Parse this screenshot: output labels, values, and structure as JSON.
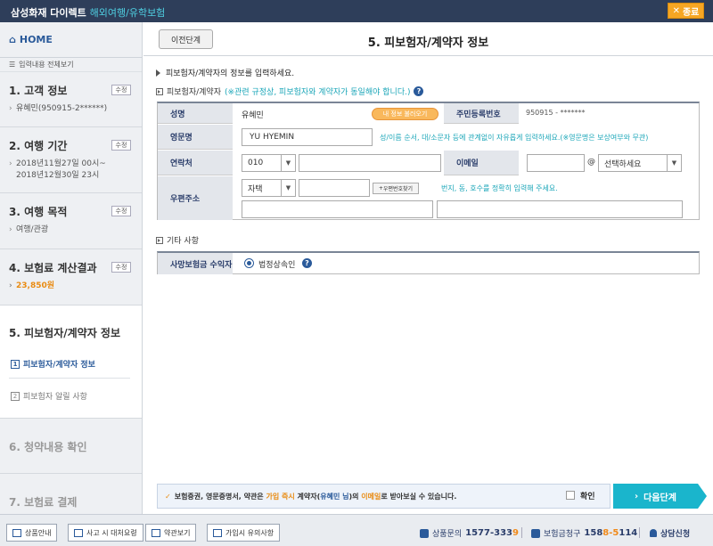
{
  "header": {
    "brand": "삼성화재 다이렉트",
    "sub": "해외여행/유학보험",
    "close": "종료"
  },
  "sidebar": {
    "home": "HOME",
    "all_view": "입력내용 전체보기",
    "edit_label": "수정",
    "steps": [
      {
        "title": "1. 고객 정보",
        "sub": "유혜민(950915-2******)"
      },
      {
        "title": "2. 여행 기간",
        "sub1": "2018년11월27일 00시~",
        "sub2": "2018년12월30일 23시"
      },
      {
        "title": "3. 여행 목적",
        "sub": "여행/관광"
      },
      {
        "title": "4. 보험료 계산결과",
        "sub": "23,850원"
      },
      {
        "title": "5. 피보험자/계약자 정보",
        "items": [
          {
            "num": "1",
            "label": "피보험자/계약자 정보"
          },
          {
            "num": "2",
            "label": "피보험자 알릴 사항"
          }
        ]
      },
      {
        "title": "6. 청약내용 확인"
      },
      {
        "title": "7. 보험료 결제"
      }
    ]
  },
  "main": {
    "prev_button": "이전단계",
    "title": "5. 피보험자/계약자 정보",
    "instruction": "피보험자/계약자의 정보를 입력하세요.",
    "section1": {
      "title": "피보험자/계약자",
      "note": "(※관련 규정상, 피보험자와 계약자가 동일해야 합니다.)"
    },
    "form": {
      "name_label": "성명",
      "name_value": "유혜민",
      "name_button": "내 정보 불러오기",
      "rrn_label": "주민등록번호",
      "rrn_value": "950915 - *******",
      "eng_label": "영문명",
      "eng_value": "YU HYEMIN",
      "eng_hint": "성/이름 순서, 대/소문자 등에 관계없이 자유롭게 입력하세요.(※영문명은 보상여부와 무관)",
      "phone_label": "연락처",
      "phone_prefix": "010",
      "phone_value": "",
      "email_label": "이메일",
      "email_at": "@",
      "email_domain_placeholder": "선택하세요",
      "addr_label": "우편주소",
      "addr_type": "자택",
      "postcode_button": "우편번호찾기",
      "addr_hint": "번지, 동, 호수를 정확히 입력해 주세요."
    },
    "section2": {
      "title": "기타 사항"
    },
    "beneficiary": {
      "label": "사망보험금 수익자",
      "option": "법정상속인"
    },
    "notice": {
      "p1": "보험증권, 영문증명서, 약관은 ",
      "h1": "가입 즉시",
      "p2": " 계약자(",
      "h2": "유혜민 님",
      "p3": ")의 ",
      "h3": "이메일",
      "p4": "로 받아보실 수 있습니다.",
      "confirm": "확인"
    },
    "next_button": "다음단계"
  },
  "footer": {
    "buttons": [
      "상품안내",
      "사고 시 대처요령",
      "약관보기",
      "가입시 유의사항"
    ],
    "contact_label": "상품문의",
    "contact_main": "1577-333",
    "contact_tail": "9",
    "claim_label": "보험금청구",
    "claim_a": "158",
    "claim_b": "8-5",
    "claim_c": "114",
    "consult": "상담신청"
  }
}
